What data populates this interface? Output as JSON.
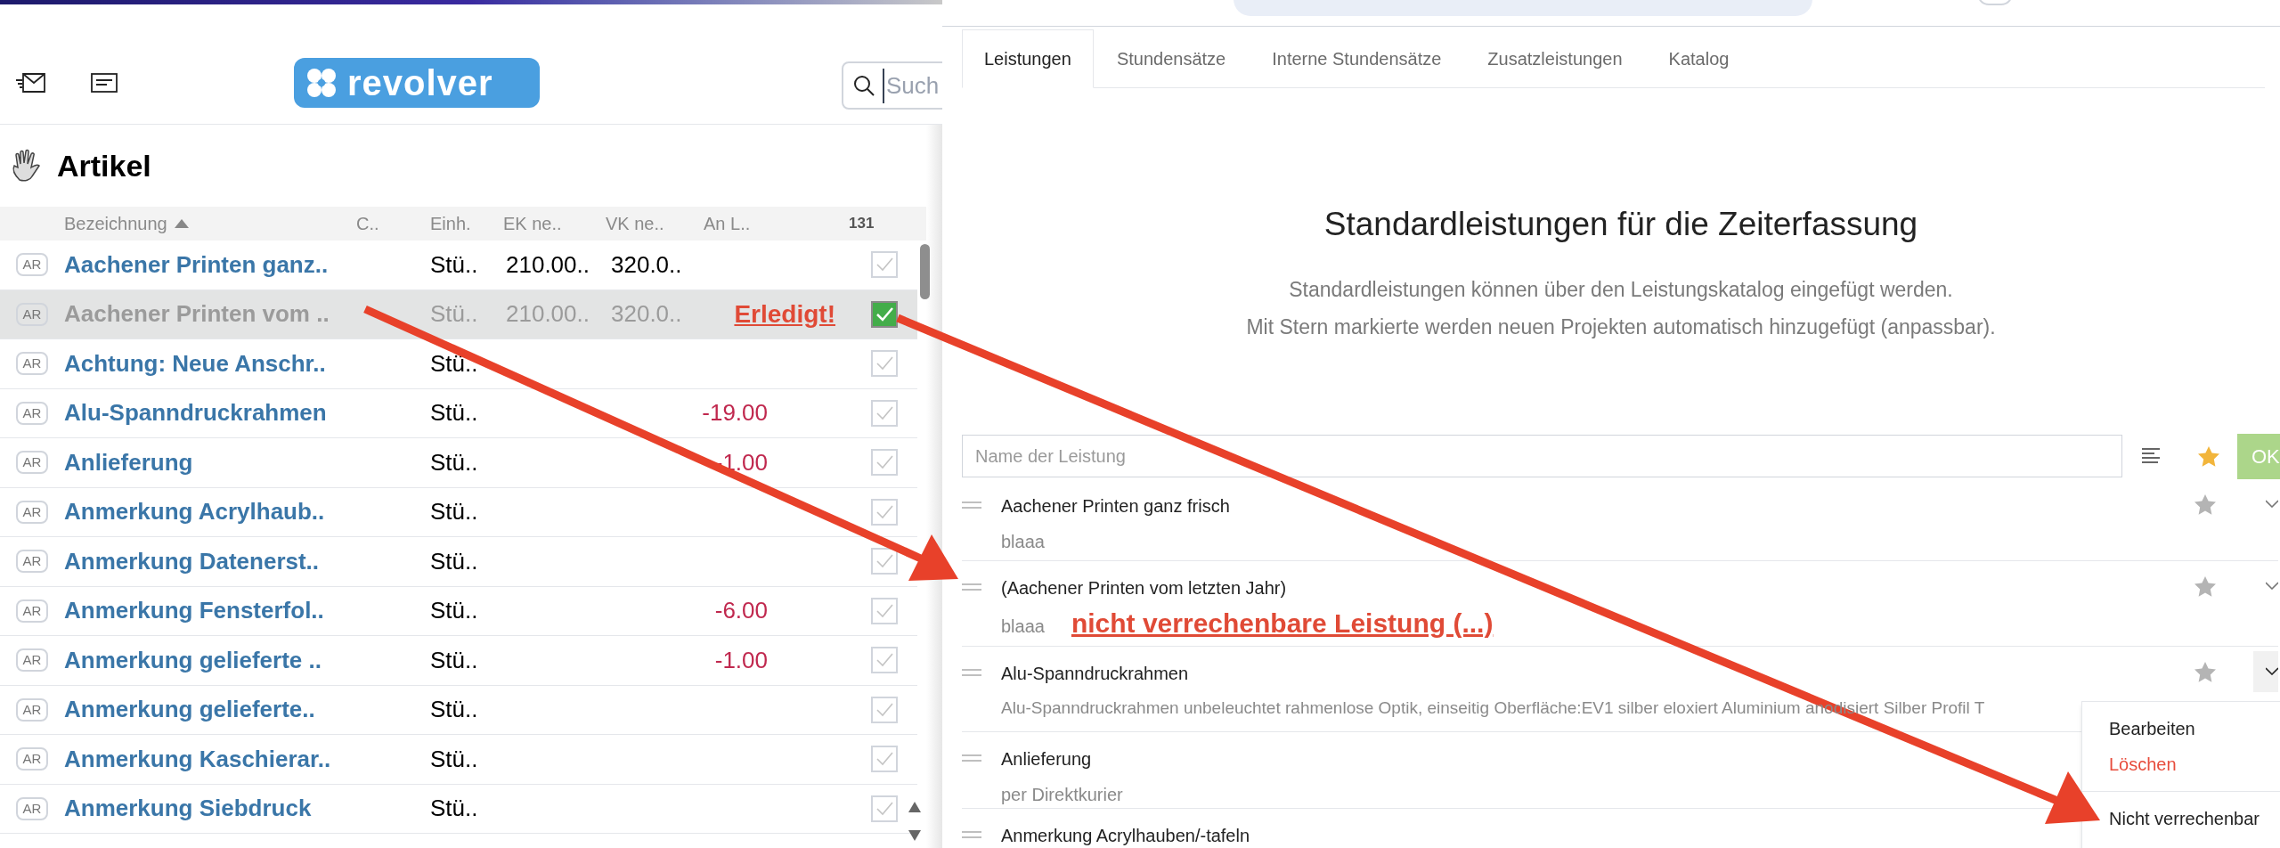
{
  "left_panel": {
    "logo": "revolver",
    "search": {
      "placeholder": "Such"
    },
    "title": "Artikel",
    "columns": [
      {
        "label": "Bezeichnung",
        "sorted": true
      },
      {
        "label": "C.."
      },
      {
        "label": "Einh."
      },
      {
        "label": "EK ne.."
      },
      {
        "label": "VK ne.."
      },
      {
        "label": "An L.."
      }
    ],
    "count": "131",
    "rows": [
      {
        "badge": "AR",
        "name": "Aachener Printen ganz..",
        "unit": "Stü..",
        "ek": "210.00..",
        "vk": "320.0..",
        "checked": false,
        "selected": false
      },
      {
        "badge": "AR",
        "name": "Aachener Printen vom ..",
        "unit": "Stü..",
        "ek": "210.00..",
        "vk": "320.0..",
        "annotation": "Erledigt!",
        "checked": true,
        "selected": true
      },
      {
        "badge": "AR",
        "name": "Achtung: Neue Anschr..",
        "unit": "Stü..",
        "checked": false,
        "selected": false
      },
      {
        "badge": "AR",
        "name": "Alu-Spanndruckrahmen",
        "unit": "Stü..",
        "an_l": "-19.00",
        "checked": false,
        "selected": false
      },
      {
        "badge": "AR",
        "name": "Anlieferung",
        "unit": "Stü..",
        "an_l": "-1.00",
        "checked": false,
        "selected": false
      },
      {
        "badge": "AR",
        "name": "Anmerkung Acrylhaub..",
        "unit": "Stü..",
        "checked": false,
        "selected": false
      },
      {
        "badge": "AR",
        "name": "Anmerkung Datenerst..",
        "unit": "Stü..",
        "checked": false,
        "selected": false
      },
      {
        "badge": "AR",
        "name": "Anmerkung Fensterfol..",
        "unit": "Stü..",
        "an_l": "-6.00",
        "checked": false,
        "selected": false
      },
      {
        "badge": "AR",
        "name": "Anmerkung gelieferte ..",
        "unit": "Stü..",
        "an_l": "-1.00",
        "checked": false,
        "selected": false
      },
      {
        "badge": "AR",
        "name": "Anmerkung gelieferte..",
        "unit": "Stü..",
        "checked": false,
        "selected": false
      },
      {
        "badge": "AR",
        "name": "Anmerkung Kaschierar..",
        "unit": "Stü..",
        "checked": false,
        "selected": false
      },
      {
        "badge": "AR",
        "name": "Anmerkung Siebdruck",
        "unit": "Stü..",
        "checked": false,
        "selected": false
      }
    ]
  },
  "right_panel": {
    "tabs": [
      {
        "label": "Leistungen",
        "selected": true
      },
      {
        "label": "Stundensätze",
        "selected": false
      },
      {
        "label": "Interne Stundensätze",
        "selected": false
      },
      {
        "label": "Zusatzleistungen",
        "selected": false
      },
      {
        "label": "Katalog",
        "selected": false
      }
    ],
    "heading": "Standardleistungen für die Zeiterfassung",
    "description": [
      "Standardleistungen können über den Leistungskatalog eingefügt werden.",
      "Mit Stern markierte werden neuen Projekten automatisch hinzugefügt (anpassbar)."
    ],
    "input": {
      "placeholder": "Name der Leistung",
      "starred": true
    },
    "ok_button": "OK",
    "items": [
      {
        "title": "Aachener Printen ganz frisch",
        "subtitle": "blaaa",
        "starred": false,
        "menu_open": false
      },
      {
        "title": "(Aachener Printen vom letzten Jahr)",
        "subtitle": "blaaa",
        "annotation": "nicht verrechenbare Leistung (...)",
        "starred": false,
        "menu_open": false
      },
      {
        "title": "Alu-Spanndruckrahmen",
        "subtitle": "Alu-Spanndruckrahmen unbeleuchtet rahmenlose Optik, einseitig Oberfläche:EV1 silber eloxiert Aluminium anodisiert Silber Profil T",
        "starred": false,
        "menu_open": true
      },
      {
        "title": "Anlieferung",
        "subtitle": "per Direktkurier"
      },
      {
        "title": "Anmerkung Acrylhauben/-tafeln"
      }
    ],
    "menu": [
      {
        "label": "Bearbeiten",
        "kind": "normal"
      },
      {
        "label": "Löschen",
        "kind": "danger"
      },
      {
        "label": "Nicht verrechenbar",
        "kind": "separated"
      }
    ]
  }
}
